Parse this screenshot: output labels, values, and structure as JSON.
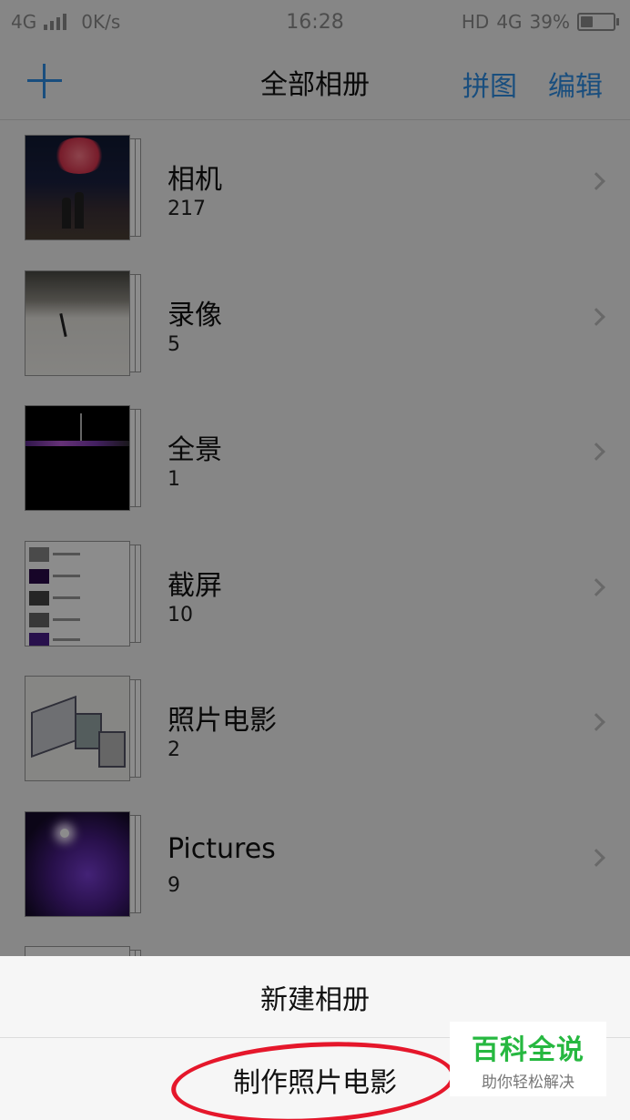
{
  "status_bar": {
    "network": "4G",
    "speed": "0K/s",
    "time": "16:28",
    "hd": "HD",
    "network_right": "4G",
    "battery": "39%"
  },
  "header": {
    "title": "全部相册",
    "collage_label": "拼图",
    "edit_label": "编辑",
    "add_icon": "plus-icon"
  },
  "albums": [
    {
      "name": "相机",
      "count": "217"
    },
    {
      "name": "录像",
      "count": "5"
    },
    {
      "name": "全景",
      "count": "1"
    },
    {
      "name": "截屏",
      "count": "10"
    },
    {
      "name": "照片电影",
      "count": "2"
    },
    {
      "name": "Pictures",
      "count": "9"
    }
  ],
  "sheet": {
    "new_album": "新建相册",
    "make_movie": "制作照片电影"
  },
  "watermark": {
    "title": "百科全说",
    "subtitle": "助你轻松解决"
  },
  "colors": {
    "accent": "#2f8fe6",
    "annotation": "#e5172b",
    "watermark_green": "#26b840"
  }
}
